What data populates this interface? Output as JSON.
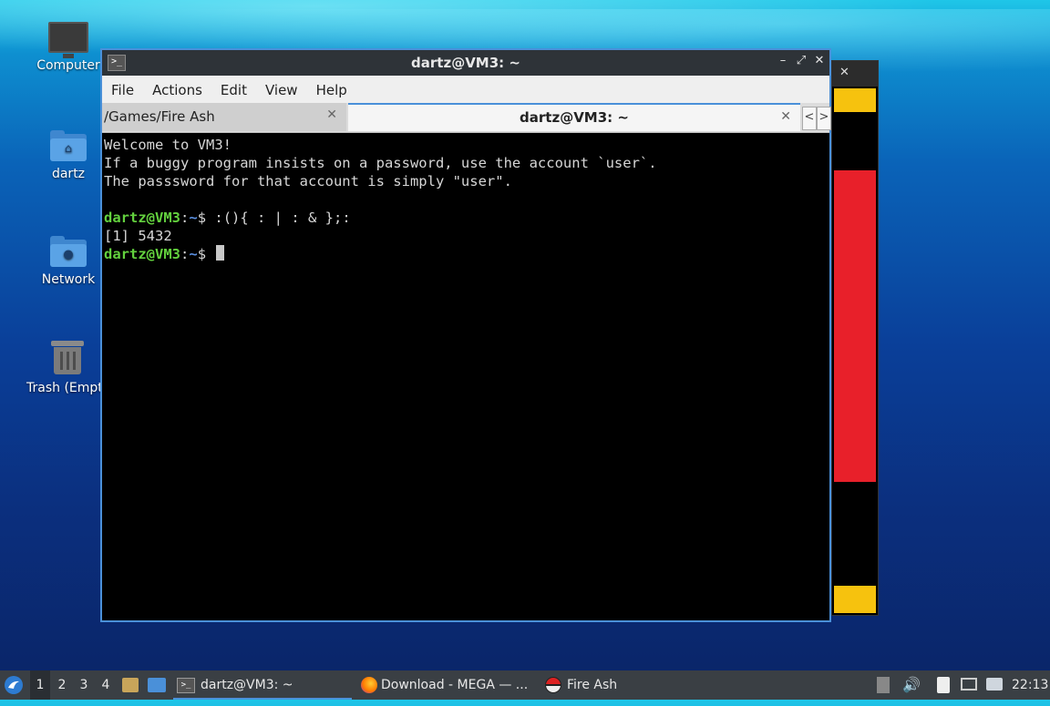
{
  "desktop": {
    "icons": [
      {
        "label": "Computer"
      },
      {
        "label": "dartz"
      },
      {
        "label": "Network"
      },
      {
        "label": "Trash (Empt"
      }
    ]
  },
  "window": {
    "title": "dartz@VM3: ~",
    "menu": [
      "File",
      "Actions",
      "Edit",
      "View",
      "Help"
    ],
    "tabs": [
      {
        "label": "/Games/Fire Ash",
        "active": false
      },
      {
        "label": "dartz@VM3: ~",
        "active": true
      }
    ],
    "close_glyph": "✕",
    "minimize_glyph": "–",
    "maximize_glyph": "⤢",
    "window_close_glyph": "✕",
    "scroll_left": "<",
    "scroll_right": ">"
  },
  "terminal": {
    "welcome1": "Welcome to VM3!",
    "welcome2": "If a buggy program insists on a password, use the account `user`.",
    "welcome3": "The passsword for that account is simply \"user\".",
    "prompt_user": "dartz@VM3",
    "prompt_sep": ":",
    "prompt_dir": "~",
    "prompt_dollar": "$ ",
    "command1": ":(){ : | : & };:",
    "output1": "[1] 5432"
  },
  "taskbar": {
    "workspaces": [
      "1",
      "2",
      "3",
      "4"
    ],
    "active_workspace": "1",
    "tasks": [
      {
        "label": "dartz@VM3: ~",
        "icon": "terminal-icon"
      },
      {
        "label": "Download - MEGA — ...",
        "icon": "firefox-icon"
      },
      {
        "label": "Fire Ash",
        "icon": "pokeball-icon"
      }
    ],
    "clock": "22:13"
  },
  "colors": {
    "accent": "#4a90d9",
    "prompt_green": "#63d13e",
    "prompt_blue": "#5a8fe0",
    "stripe_yellow": "#f6c20e",
    "stripe_red": "#e8202a"
  }
}
